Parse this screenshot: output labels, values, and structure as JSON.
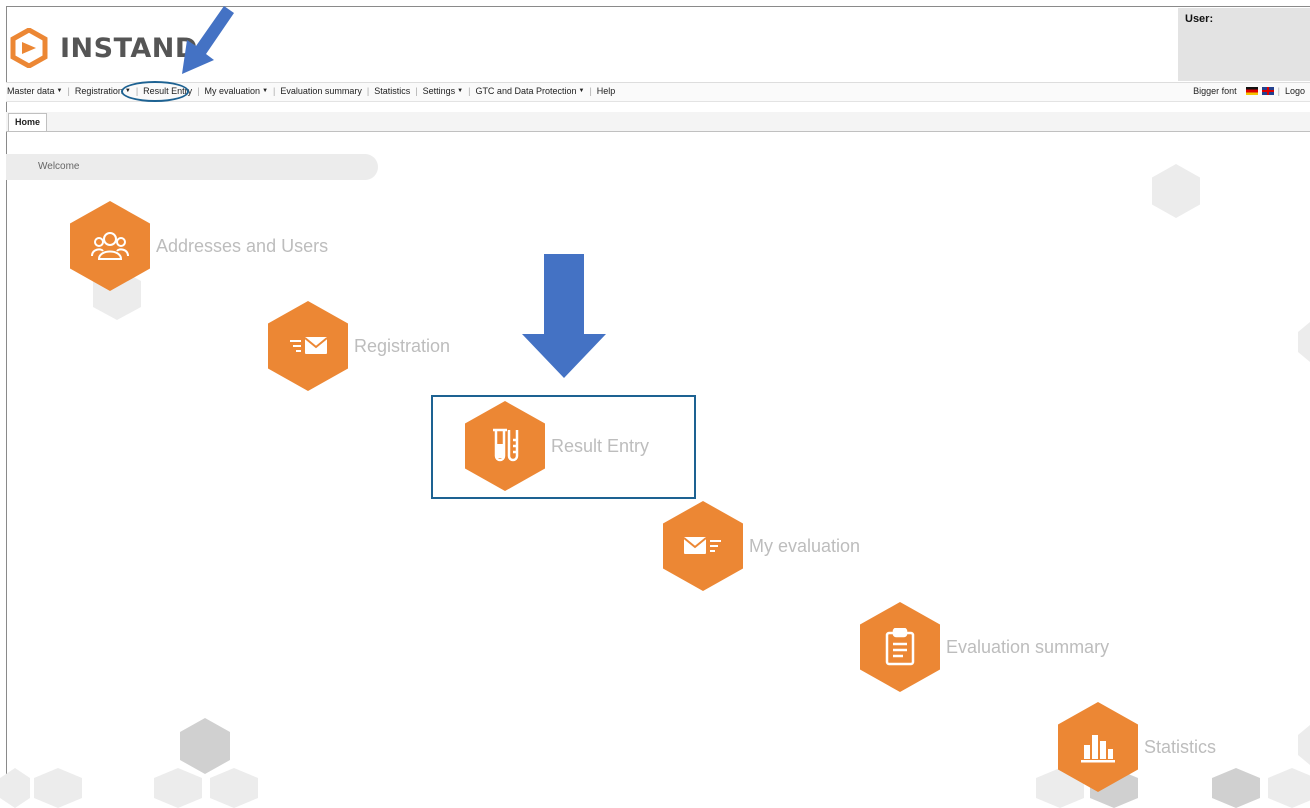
{
  "header": {
    "brand": "INSTAND",
    "user_label": "User:"
  },
  "nav": {
    "items": [
      {
        "label": "Master data",
        "dropdown": true
      },
      {
        "label": "Registration",
        "dropdown": true
      },
      {
        "label": "Result Entry",
        "dropdown": false
      },
      {
        "label": "My evaluation",
        "dropdown": true
      },
      {
        "label": "Evaluation summary",
        "dropdown": false
      },
      {
        "label": "Statistics",
        "dropdown": false
      },
      {
        "label": "Settings",
        "dropdown": true
      },
      {
        "label": "GTC and Data Protection",
        "dropdown": true
      },
      {
        "label": "Help",
        "dropdown": false
      }
    ],
    "bigger_font": "Bigger font",
    "logout": "Logo"
  },
  "tabs": [
    {
      "label": "Home"
    }
  ],
  "welcome": "Welcome",
  "tiles": [
    {
      "label": "Addresses and Users",
      "icon": "users-icon"
    },
    {
      "label": "Registration",
      "icon": "send-mail-icon"
    },
    {
      "label": "Result Entry",
      "icon": "test-tubes-icon"
    },
    {
      "label": "My evaluation",
      "icon": "receive-mail-icon"
    },
    {
      "label": "Evaluation summary",
      "icon": "clipboard-icon"
    },
    {
      "label": "Statistics",
      "icon": "bar-chart-icon"
    }
  ],
  "colors": {
    "tile_orange": "#ec8734",
    "annotation_blue": "#4472c4",
    "highlight_border": "#1d6292"
  }
}
